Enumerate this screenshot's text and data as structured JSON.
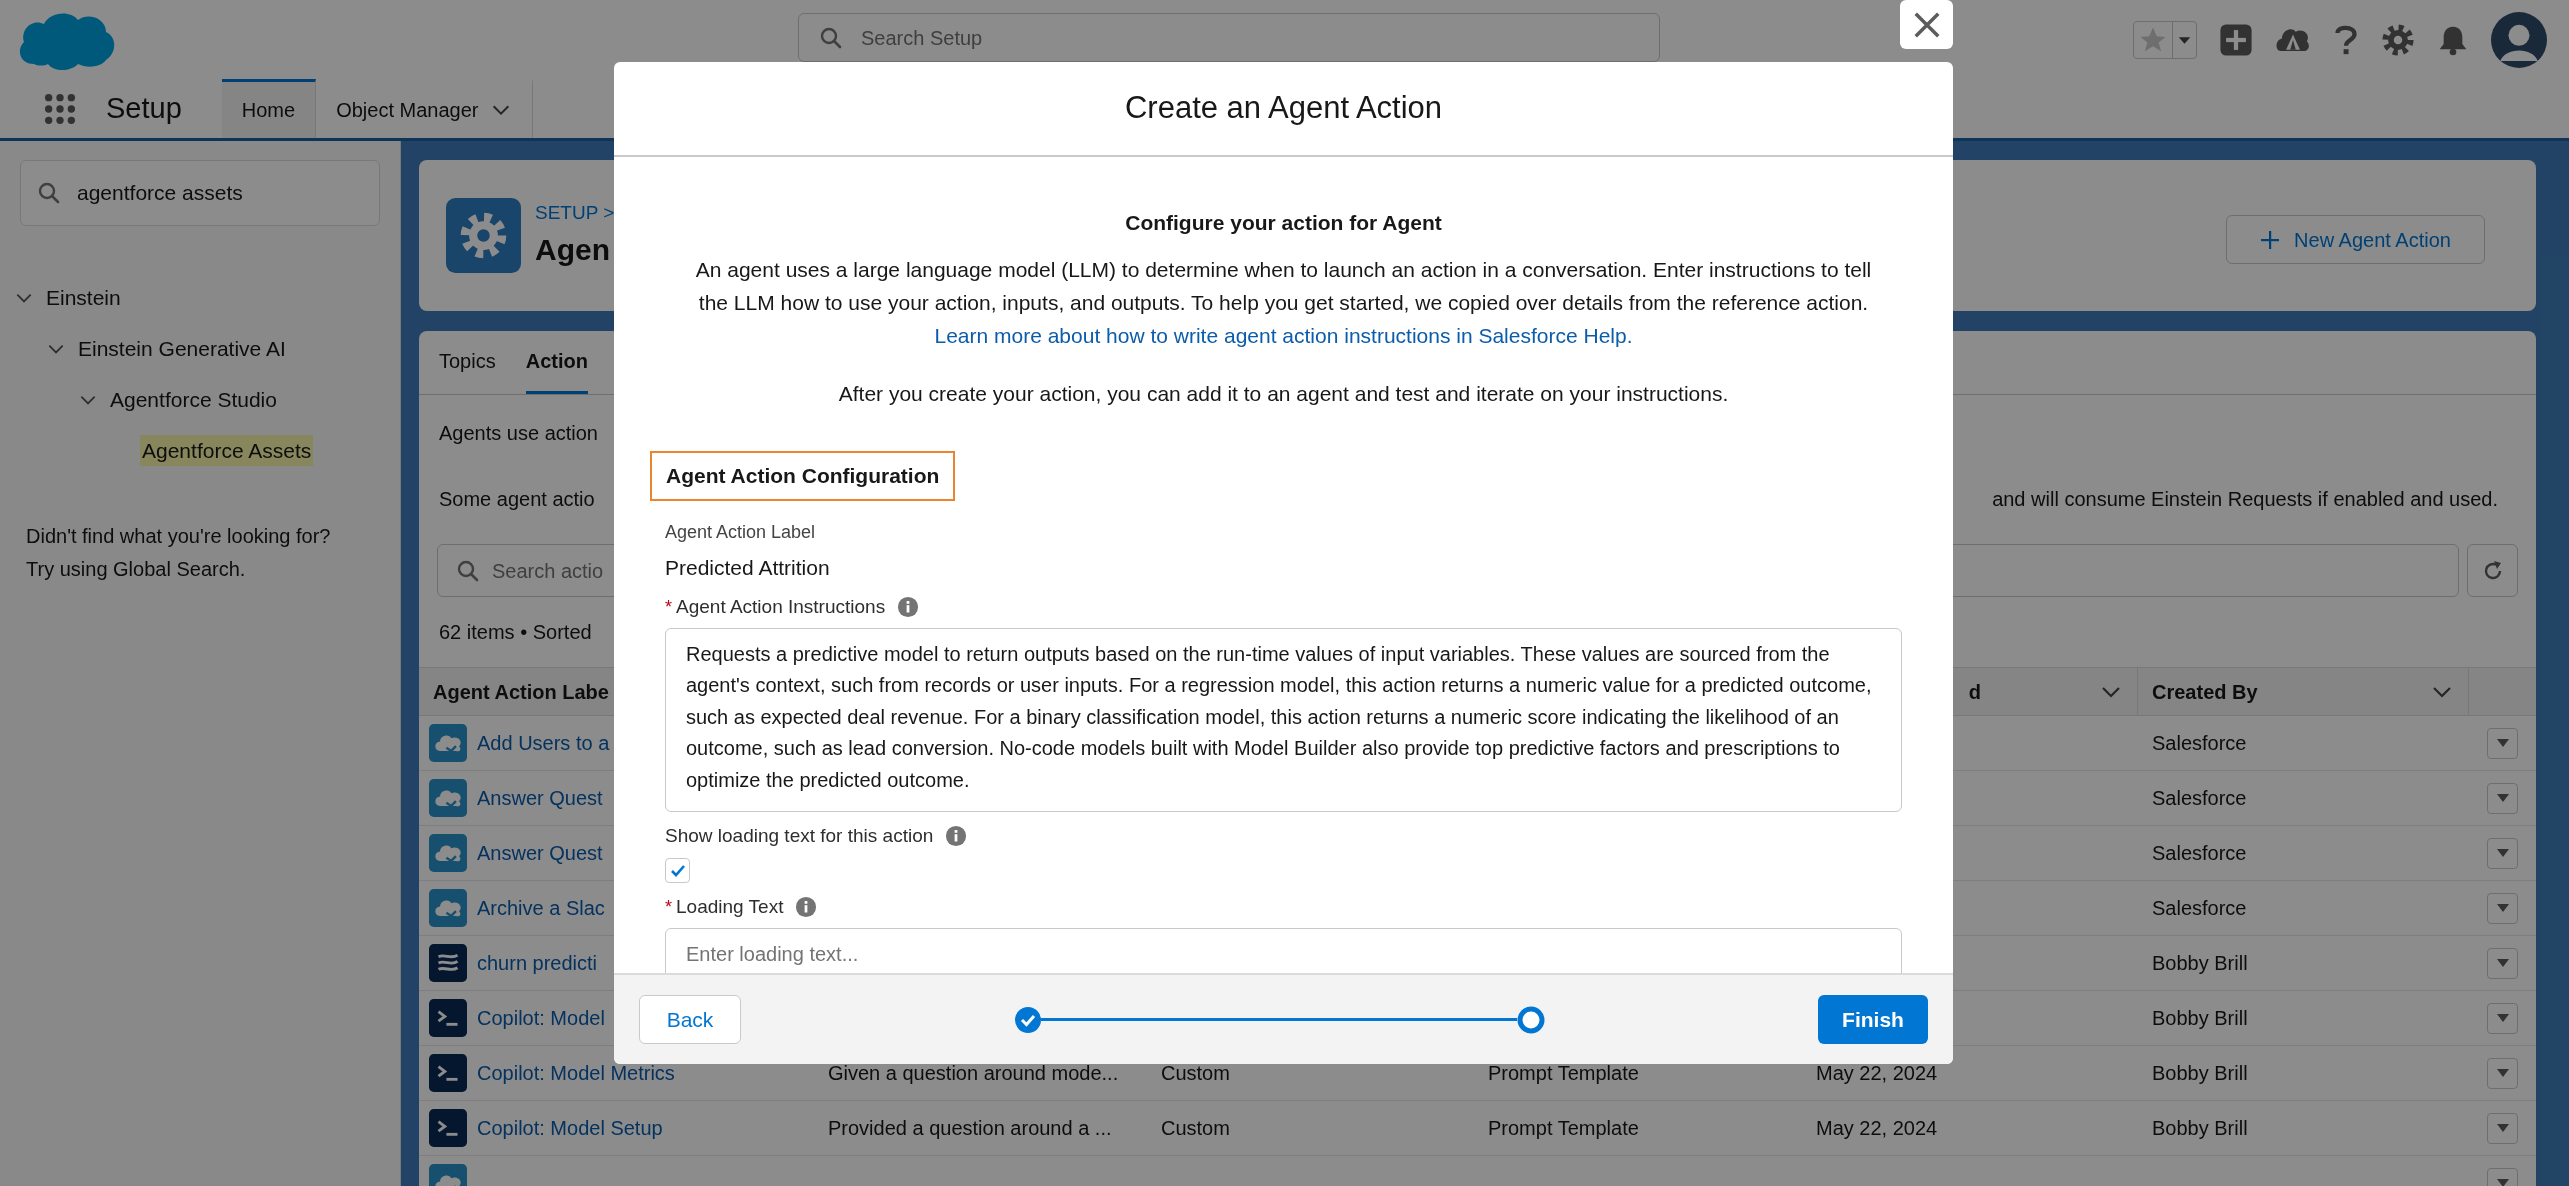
{
  "header": {
    "search": {
      "placeholder": "Search Setup"
    }
  },
  "nav": {
    "app_name": "Setup",
    "tabs": [
      {
        "label": "Home",
        "selected": true,
        "menu": false
      },
      {
        "label": "Object Manager",
        "selected": false,
        "menu": true
      }
    ]
  },
  "sidebar": {
    "search": {
      "value": "agentforce assets"
    },
    "tree": [
      {
        "label": "Einstein",
        "expanded": true,
        "selected": false,
        "children": [
          {
            "label": "Einstein Generative AI",
            "expanded": true,
            "selected": false,
            "children": [
              {
                "label": "Agentforce Studio",
                "expanded": true,
                "selected": false,
                "children": [
                  {
                    "label": "Agentforce Assets",
                    "selected": true
                  }
                ]
              }
            ]
          }
        ]
      }
    ],
    "help": [
      "Didn't find what you're looking for?",
      "Try using Global Search."
    ]
  },
  "page_header": {
    "breadcrumb": "SETUP >",
    "title": "Agen",
    "button": "New Agent Action"
  },
  "content": {
    "tabs": [
      {
        "label": "Topics",
        "selected": false
      },
      {
        "label": "Action",
        "selected": true
      }
    ],
    "intro": "Agents use action",
    "notice_left": "Some agent actio",
    "notice_right": "and will consume Einstein Requests if enabled and used.",
    "search": {
      "placeholder": "Search actio"
    },
    "summary": "62 items • Sorted"
  },
  "table": {
    "header": {
      "label": "Agent Action Labe",
      "date": "d",
      "created_by": "Created By"
    },
    "rows": [
      {
        "kind": "cloud",
        "label": "Add Users to a",
        "created_by": "Salesforce"
      },
      {
        "kind": "cloud",
        "label": "Answer Quest",
        "created_by": "Salesforce"
      },
      {
        "kind": "cloud",
        "label": "Answer Quest",
        "created_by": "Salesforce"
      },
      {
        "kind": "cloud",
        "label": "Archive a Slac",
        "created_by": "Salesforce"
      },
      {
        "kind": "waves",
        "label": "churn predicti",
        "created_by": "Bobby Brill"
      },
      {
        "kind": "prompt",
        "label": "Copilot: Model",
        "created_by": "Bobby Brill"
      },
      {
        "kind": "prompt",
        "label": "Copilot: Model Metrics",
        "description": "Given a question around mode...",
        "type": "Custom",
        "reference": "Prompt Template",
        "date": "May 22, 2024",
        "created_by": "Bobby Brill"
      },
      {
        "kind": "prompt",
        "label": "Copilot: Model Setup",
        "description": "Provided a question around a ...",
        "type": "Custom",
        "reference": "Prompt Template",
        "date": "May 22, 2024",
        "created_by": "Bobby Brill"
      },
      {
        "kind": "cloud"
      }
    ]
  },
  "modal": {
    "title": "Create an Agent Action",
    "heading": "Configure your action for Agent",
    "description": "An agent uses a large language model (LLM) to determine when to launch an action in a conversation. Enter instructions to tell the LLM how to use your action, inputs, and outputs. To help you get started, we copied over details from the reference action.",
    "link": "Learn more about how to write agent action instructions in Salesforce Help.",
    "note": "After you create your action, you can add it to an agent and test and iterate on your instructions.",
    "section": {
      "title": "Agent Action Configuration",
      "highlighted": true
    },
    "fields": [
      {
        "kind": "readonly",
        "label": "Agent Action Label",
        "value": "Predicted Attrition"
      },
      {
        "kind": "textarea",
        "label": "Agent Action Instructions",
        "required_mark": "*",
        "info": true,
        "value": "Requests a predictive model to return outputs based on the run-time values of input variables. These values are sourced from the agent's context, such from records or user inputs. For a regression model, this action returns a numeric value for a predicted outcome, such as expected deal revenue. For a binary classification model, this action returns a numeric score indicating the likelihood of an outcome, such as lead conversion. No-code models built with Model Builder also provide top predictive factors and prescriptions to optimize the predicted outcome."
      },
      {
        "kind": "checkbox",
        "label": "Show loading text for this action",
        "info": true,
        "checked": true
      },
      {
        "kind": "input",
        "label": "Loading Text",
        "required_mark": "*",
        "info": true,
        "placeholder": "Enter loading text..."
      }
    ],
    "steps": [
      {
        "kind": "complete"
      },
      {
        "kind": "current"
      }
    ],
    "back": "Back",
    "finish": "Finish"
  }
}
